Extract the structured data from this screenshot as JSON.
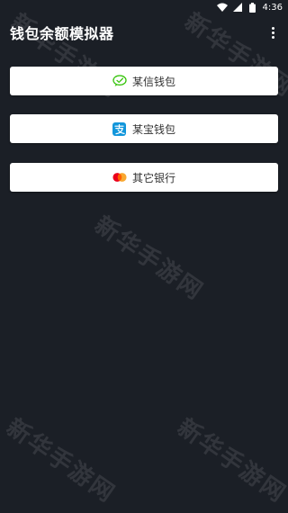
{
  "status_bar": {
    "time": "4:36"
  },
  "app_bar": {
    "title": "钱包余额模拟器"
  },
  "options": [
    {
      "label": "某信钱包",
      "icon": "wechat-icon",
      "color": "#2dc100"
    },
    {
      "label": "某宝钱包",
      "icon": "alipay-icon",
      "color": "#1296db"
    },
    {
      "label": "其它银行",
      "icon": "mastercard-icon",
      "color": "#eb001b"
    }
  ],
  "watermark": {
    "text": "新华手游网"
  }
}
